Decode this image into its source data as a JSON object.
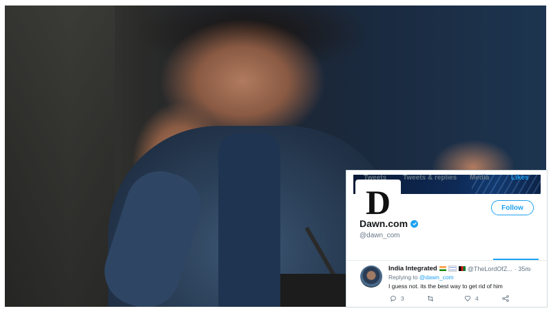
{
  "profile": {
    "avatar_letter": "D",
    "follow_label": "Follow",
    "name": "Dawn.com",
    "handle": "@dawn_com"
  },
  "tabs": [
    {
      "label": "Tweets"
    },
    {
      "label": "Tweets & replies"
    },
    {
      "label": "Media"
    },
    {
      "label": "Likes",
      "active": true
    }
  ],
  "tweet": {
    "author": "India Integrated",
    "handle": "@TheLordOfZ...",
    "time": "· 35m",
    "replying_prefix": "Replying to ",
    "replying_to": "@dawn_com",
    "text": "I guess not. its the best way to get rid of him",
    "reply_count": "3",
    "like_count": "4"
  },
  "colors": {
    "accent": "#1da1f2",
    "text_primary": "#14171a",
    "text_secondary": "#657786"
  }
}
